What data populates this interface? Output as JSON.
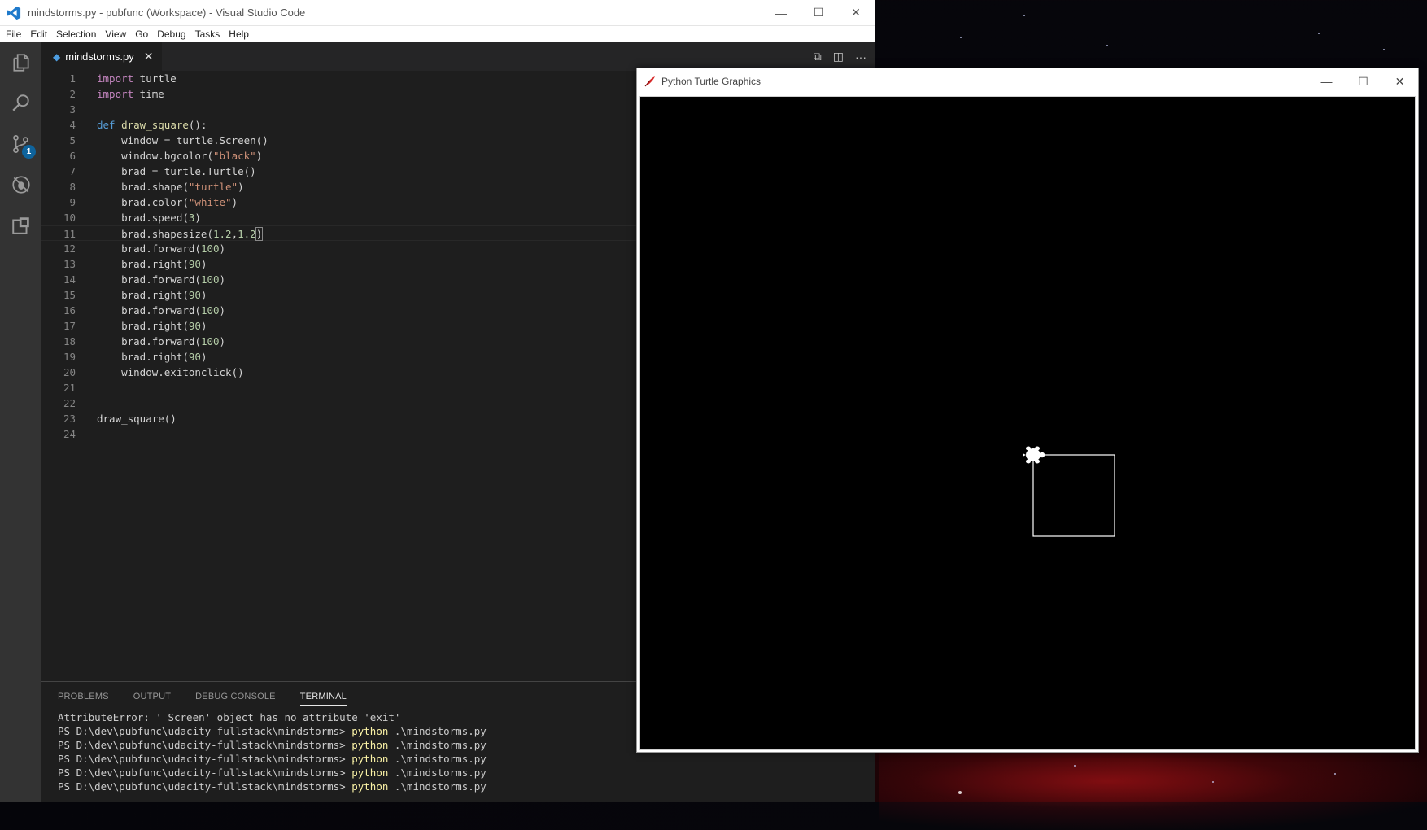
{
  "vscode": {
    "title": "mindstorms.py - pubfunc (Workspace) - Visual Studio Code",
    "menu": [
      "File",
      "Edit",
      "Selection",
      "View",
      "Go",
      "Debug",
      "Tasks",
      "Help"
    ],
    "tab": {
      "label": "mindstorms.py"
    },
    "activity_bar": {
      "items": [
        "explorer-icon",
        "search-icon",
        "source-control-icon",
        "debug-icon",
        "extensions-icon"
      ],
      "source_control_badge": "1"
    },
    "code_lines": [
      {
        "n": "1"
      },
      {
        "n": "2"
      },
      {
        "n": "3"
      },
      {
        "n": "4"
      },
      {
        "n": "5"
      },
      {
        "n": "6"
      },
      {
        "n": "7"
      },
      {
        "n": "8"
      },
      {
        "n": "9"
      },
      {
        "n": "10"
      },
      {
        "n": "11"
      },
      {
        "n": "12"
      },
      {
        "n": "13"
      },
      {
        "n": "14"
      },
      {
        "n": "15"
      },
      {
        "n": "16"
      },
      {
        "n": "17"
      },
      {
        "n": "18"
      },
      {
        "n": "19"
      },
      {
        "n": "20"
      },
      {
        "n": "21"
      },
      {
        "n": "22"
      },
      {
        "n": "23"
      },
      {
        "n": "24"
      }
    ],
    "code": {
      "l1a": "import",
      "l1b": " turtle",
      "l2a": "import",
      "l2b": " time",
      "l4a": "def",
      "l4b": " ",
      "l4c": "draw_square",
      "l4d": "():",
      "l5": "    window = turtle.Screen()",
      "l6a": "    window.bgcolor(",
      "l6b": "\"black\"",
      "l6c": ")",
      "l7": "    brad = turtle.Turtle()",
      "l8a": "    brad.shape(",
      "l8b": "\"turtle\"",
      "l8c": ")",
      "l9a": "    brad.color(",
      "l9b": "\"white\"",
      "l9c": ")",
      "l10a": "    brad.speed(",
      "l10b": "3",
      "l10c": ")",
      "l11a": "    brad.shapesize(",
      "l11b": "1.2",
      "l11c": ",",
      "l11d": "1.2",
      "l11e": ")",
      "l12a": "    brad.forward(",
      "l12b": "100",
      "l12c": ")",
      "l13a": "    brad.right(",
      "l13b": "90",
      "l13c": ")",
      "l14a": "    brad.forward(",
      "l14b": "100",
      "l14c": ")",
      "l15a": "    brad.right(",
      "l15b": "90",
      "l15c": ")",
      "l16a": "    brad.forward(",
      "l16b": "100",
      "l16c": ")",
      "l17a": "    brad.right(",
      "l17b": "90",
      "l17c": ")",
      "l18a": "    brad.forward(",
      "l18b": "100",
      "l18c": ")",
      "l19a": "    brad.right(",
      "l19b": "90",
      "l19c": ")",
      "l20": "    window.exitonclick()",
      "l23": "draw_square()"
    },
    "panel": {
      "tabs": [
        "PROBLEMS",
        "OUTPUT",
        "DEBUG CONSOLE",
        "TERMINAL"
      ],
      "active_tab": "TERMINAL",
      "terminal": {
        "error": "AttributeError: '_Screen' object has no attribute 'exit'",
        "prompt": "PS D:\\dev\\pubfunc\\udacity-fullstack\\mindstorms> ",
        "command": "python",
        "arg": " .\\mindstorms.py"
      }
    }
  },
  "turtle_window": {
    "title": "Python Turtle Graphics"
  }
}
